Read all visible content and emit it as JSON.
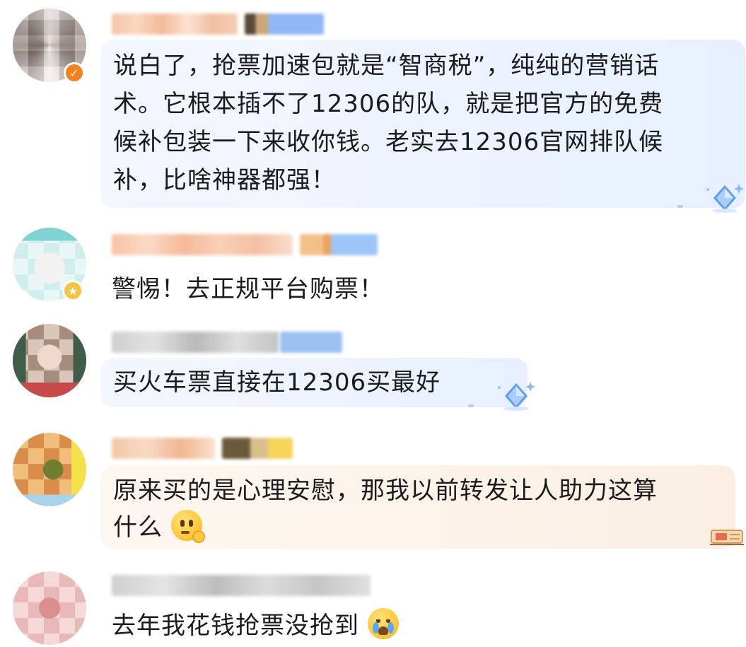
{
  "comments": [
    {
      "text": "说白了，抢票加速包就是“智商税”，纯纯的营销话术。它根本插不了12306的队，就是把官方的免费候补包装一下来收你钱。老实去12306官网排队候补，比啥神器都强！",
      "lines": [
        "说白了，抢票加速包就是“智商税”，纯纯的营销话",
        "术。它根本插不了12306的队，就是把官方的免费",
        "候补包装一下来收你钱。老实去12306官网排队候",
        "补，比啥神器都强！"
      ],
      "avatar_badge": "verified-check-icon",
      "bubble_style": "blue-gem"
    },
    {
      "text": "警惕！去正规平台购票！",
      "lines": [
        "警惕！去正规平台购票！"
      ],
      "avatar_badge": "yellow-star-icon",
      "bubble_style": "none"
    },
    {
      "text": "买火车票直接在12306买最好",
      "lines": [
        "买火车票直接在12306买最好"
      ],
      "avatar_badge": "",
      "bubble_style": "blue-gem"
    },
    {
      "text": "原来买的是心理安慰，那我以前转发让人助力这算什么",
      "lines": [
        "原来买的是心理安慰，那我以前转发让人助力这算",
        "什么"
      ],
      "emoji": "thinking-face-icon",
      "avatar_badge": "",
      "bubble_style": "warm-ticket"
    },
    {
      "text": "去年我花钱抢票没抢到",
      "lines": [
        "去年我花钱抢票没抢到"
      ],
      "emoji": "loudly-crying-face-icon",
      "avatar_badge": "",
      "bubble_style": "none"
    }
  ],
  "colors": {
    "verified_badge": "#f5821f",
    "star_badge": "#f6c343",
    "blue_bubble": "#eaf1ff",
    "warm_bubble": "#fcf1e6",
    "text": "#1b1b1b"
  }
}
